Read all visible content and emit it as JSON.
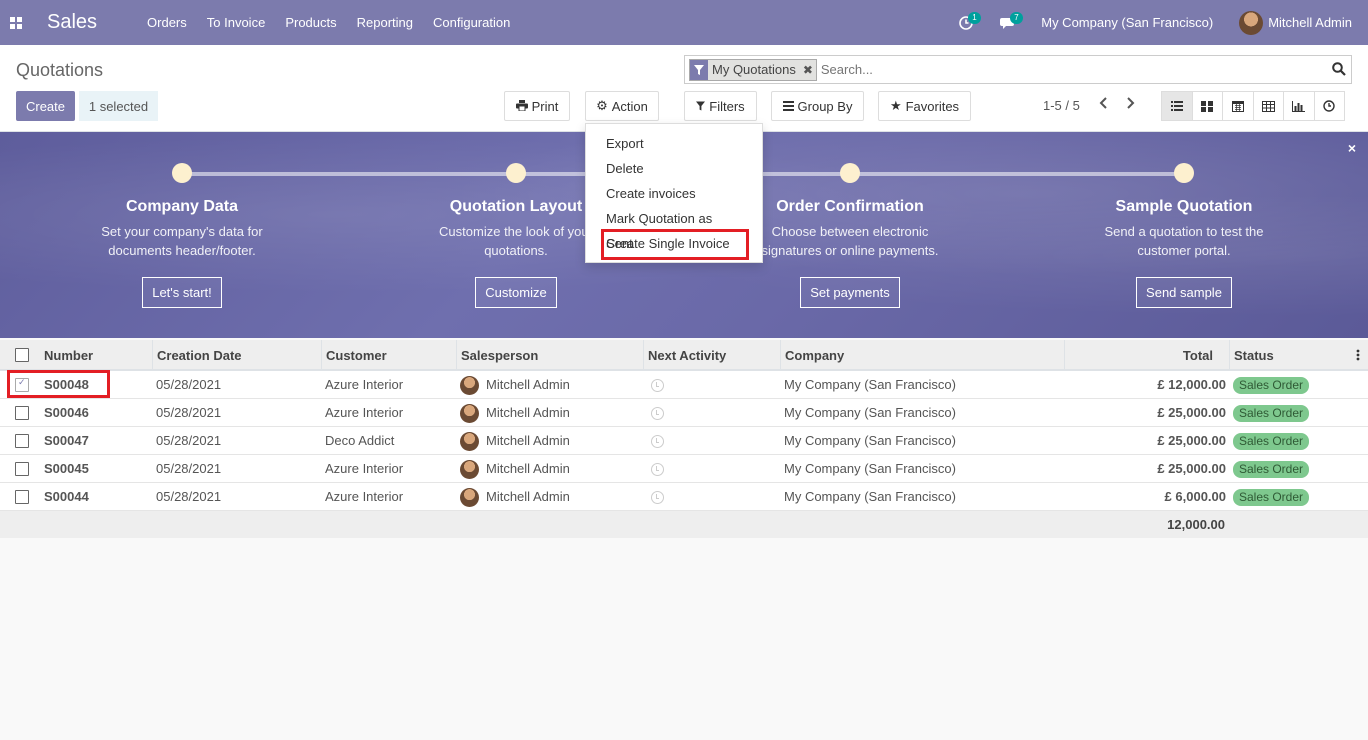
{
  "navbar": {
    "app_name": "Sales",
    "menu": [
      "Orders",
      "To Invoice",
      "Products",
      "Reporting",
      "Configuration"
    ],
    "activity_count": "1",
    "messages_count": "7",
    "company": "My Company (San Francisco)",
    "user": "Mitchell Admin"
  },
  "control_panel": {
    "title": "Quotations",
    "create_label": "Create",
    "selected_label": "1 selected",
    "print_label": "Print",
    "action_label": "Action",
    "filters_label": "Filters",
    "groupby_label": "Group By",
    "favorites_label": "Favorites",
    "pager": "1-5 / 5",
    "search_facet": "My Quotations",
    "search_placeholder": "Search..."
  },
  "action_menu": {
    "items": [
      "Export",
      "Delete",
      "Create invoices",
      "Mark Quotation as Sent",
      "Create Single Invoice"
    ]
  },
  "banner": {
    "steps": [
      {
        "title": "Company Data",
        "desc1": "Set your company's data for",
        "desc2": "documents header/footer.",
        "button": "Let's start!"
      },
      {
        "title": "Quotation Layout",
        "desc1": "Customize the look of your",
        "desc2": "quotations.",
        "button": "Customize"
      },
      {
        "title": "Order Confirmation",
        "desc1": "Choose between electronic",
        "desc2": "signatures or online payments.",
        "button": "Set payments"
      },
      {
        "title": "Sample Quotation",
        "desc1": "Send a quotation to test the",
        "desc2": "customer portal.",
        "button": "Send sample"
      }
    ],
    "close_icon": "×"
  },
  "table": {
    "headers": {
      "number": "Number",
      "creation_date": "Creation Date",
      "customer": "Customer",
      "salesperson": "Salesperson",
      "next_activity": "Next Activity",
      "company": "Company",
      "total": "Total",
      "status": "Status"
    },
    "rows": [
      {
        "number": "S00048",
        "date": "05/28/2021",
        "customer": "Azure Interior",
        "salesperson": "Mitchell Admin",
        "company": "My Company (San Francisco)",
        "total": "£ 12,000.00",
        "status": "Sales Order",
        "checked": true
      },
      {
        "number": "S00046",
        "date": "05/28/2021",
        "customer": "Azure Interior",
        "salesperson": "Mitchell Admin",
        "company": "My Company (San Francisco)",
        "total": "£ 25,000.00",
        "status": "Sales Order",
        "checked": false
      },
      {
        "number": "S00047",
        "date": "05/28/2021",
        "customer": "Deco Addict",
        "salesperson": "Mitchell Admin",
        "company": "My Company (San Francisco)",
        "total": "£ 25,000.00",
        "status": "Sales Order",
        "checked": false
      },
      {
        "number": "S00045",
        "date": "05/28/2021",
        "customer": "Azure Interior",
        "salesperson": "Mitchell Admin",
        "company": "My Company (San Francisco)",
        "total": "£ 25,000.00",
        "status": "Sales Order",
        "checked": false
      },
      {
        "number": "S00044",
        "date": "05/28/2021",
        "customer": "Azure Interior",
        "salesperson": "Mitchell Admin",
        "company": "My Company (San Francisco)",
        "total": "£ 6,000.00",
        "status": "Sales Order",
        "checked": false
      }
    ],
    "footer_sum": "12,000.00"
  },
  "colors": {
    "brand": "#7c7bad",
    "highlight": "#e31e24",
    "status_badge": "#7ec88e"
  }
}
